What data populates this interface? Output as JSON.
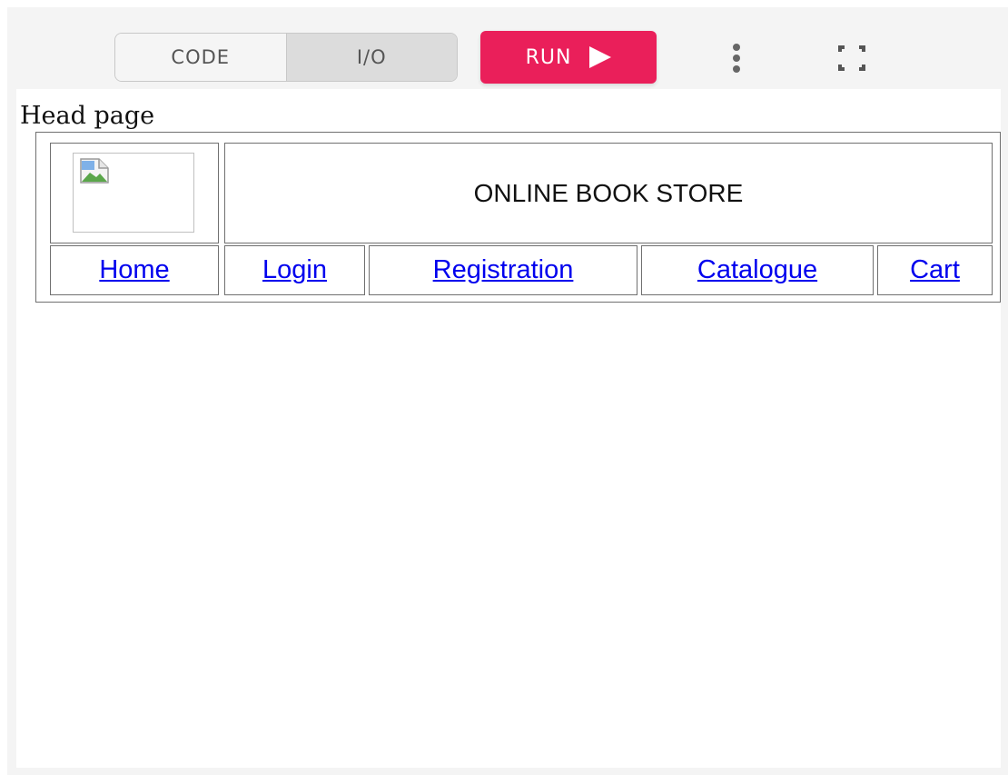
{
  "toolbar": {
    "code_label": "CODE",
    "io_label": "I/O",
    "run_label": "RUN",
    "accent_color": "#ea1f5a"
  },
  "icons": {
    "run": "play-icon",
    "menu": "more-vertical-icon",
    "expand": "fullscreen-icon",
    "image": "broken-image-icon"
  },
  "output": {
    "heading": "Head page",
    "store_title": "ONLINE BOOK STORE",
    "nav": [
      {
        "label": "Home"
      },
      {
        "label": "Login"
      },
      {
        "label": "Registration"
      },
      {
        "label": "Catalogue"
      },
      {
        "label": "Cart"
      }
    ],
    "link_color": "#0000ee"
  }
}
